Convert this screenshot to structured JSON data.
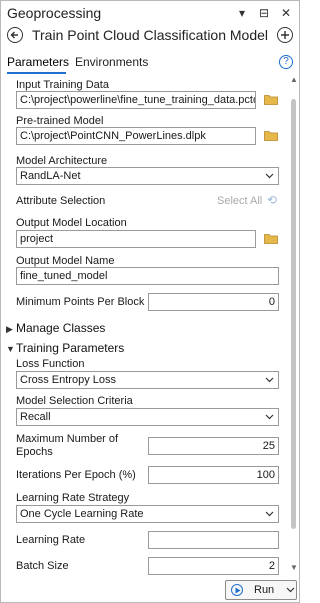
{
  "pane": {
    "title": "Geoprocessing"
  },
  "titlebar_icons": [
    {
      "name": "dropdown-icon",
      "glyph": "▾"
    },
    {
      "name": "autohide-pin-icon",
      "glyph": "⊟"
    },
    {
      "name": "close-icon",
      "glyph": "✕"
    }
  ],
  "tool": {
    "name": "Train Point Cloud Classification Model"
  },
  "tabs": [
    {
      "label": "Parameters",
      "active": true
    },
    {
      "label": "Environments",
      "active": false
    }
  ],
  "help_icon": "?",
  "params": {
    "input_training_data": {
      "label": "Input Training Data",
      "value": "C:\\project\\powerline\\fine_tune_training_data.pctd"
    },
    "pretrained_model": {
      "label": "Pre-trained Model",
      "value": "C:\\project\\PointCNN_PowerLines.dlpk"
    },
    "model_architecture": {
      "label": "Model Architecture",
      "value": "RandLA-Net"
    },
    "attribute_selection": {
      "label": "Attribute Selection",
      "select_all": "Select All"
    },
    "output_model_location": {
      "label": "Output Model Location",
      "value": "project"
    },
    "output_model_name": {
      "label": "Output Model Name",
      "value": "fine_tuned_model"
    },
    "min_points_per_block": {
      "label": "Minimum Points Per Block",
      "value": "0"
    }
  },
  "sections": {
    "manage_classes": {
      "label": "Manage Classes",
      "expanded": false
    },
    "training_parameters": {
      "label": "Training Parameters",
      "expanded": true
    }
  },
  "training": {
    "loss_function": {
      "label": "Loss Function",
      "value": "Cross Entropy Loss"
    },
    "model_selection": {
      "label": "Model Selection Criteria",
      "value": "Recall"
    },
    "max_epochs": {
      "label_line1": "Maximum Number of",
      "label_line2": "Epochs",
      "value": "25"
    },
    "iterations_per_epoch": {
      "label": "Iterations Per Epoch (%)",
      "value": "100"
    },
    "lr_strategy": {
      "label": "Learning Rate Strategy",
      "value": "One Cycle Learning Rate"
    },
    "learning_rate": {
      "label": "Learning Rate",
      "value": ""
    },
    "batch_size": {
      "label": "Batch Size",
      "value": "2"
    }
  },
  "run": {
    "label": "Run"
  },
  "colors": {
    "accent": "#1f6fcf",
    "folder": "#e0b040",
    "border": "#9a9a9a"
  }
}
